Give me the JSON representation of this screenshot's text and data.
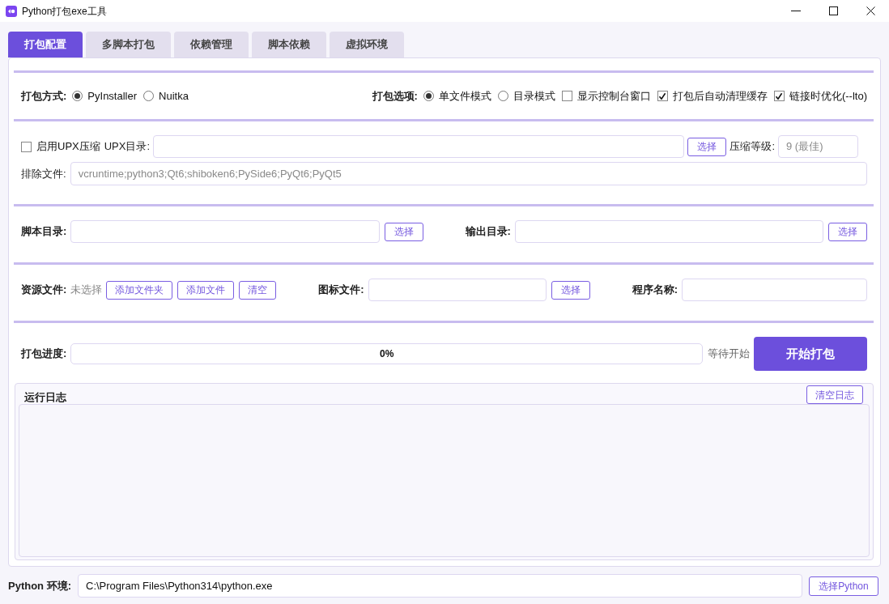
{
  "window": {
    "title": "Python打包exe工具"
  },
  "tabs": [
    {
      "label": "打包配置",
      "selected": true
    },
    {
      "label": "多脚本打包",
      "selected": false
    },
    {
      "label": "依赖管理",
      "selected": false
    },
    {
      "label": "脚本依赖",
      "selected": false
    },
    {
      "label": "虚拟环境",
      "selected": false
    }
  ],
  "packaging": {
    "method_label": "打包方式:",
    "methods": [
      {
        "label": "PyInstaller",
        "selected": true
      },
      {
        "label": "Nuitka",
        "selected": false
      }
    ],
    "options_label": "打包选项:",
    "options": [
      {
        "kind": "radio",
        "label": "单文件模式",
        "selected": true
      },
      {
        "kind": "radio",
        "label": "目录模式",
        "selected": false
      },
      {
        "kind": "checkbox",
        "label": "显示控制台窗口",
        "checked": false
      },
      {
        "kind": "checkbox",
        "label": "打包后自动清理缓存",
        "checked": true
      },
      {
        "kind": "checkbox",
        "label": "链接时优化(--lto)",
        "checked": true
      }
    ]
  },
  "upx": {
    "enable": {
      "label": "启用UPX压缩",
      "checked": false
    },
    "dir_label": "UPX目录:",
    "dir_button": "选择",
    "level_label": "压缩等级:",
    "level_field": {
      "value": "9 (最佳)",
      "disabled": true
    },
    "exclude_label": "排除文件:",
    "exclude_field": {
      "value": "vcruntime;python3;Qt6;shiboken6;PySide6;PyQt6;PyQt5",
      "disabled": true
    }
  },
  "directories": [
    {
      "label": "脚本目录:",
      "button": "选择"
    },
    {
      "label": "输出目录:",
      "button": "选择"
    }
  ],
  "resources": {
    "label": "资源文件:",
    "status": "未选择",
    "buttons": [
      "添加文件夹",
      "添加文件",
      "清空"
    ],
    "icon_label": "图标文件:",
    "icon_button": "选择",
    "name_label": "程序名称:"
  },
  "progress": {
    "label": "打包进度:",
    "level": 0,
    "reading": "0%",
    "status": "等待开始",
    "button": "开始打包"
  },
  "log": {
    "title": "运行日志",
    "button": "清空日志"
  },
  "python_env": {
    "label": "Python 环境:",
    "value": "C:\\Program Files\\Python314\\python.exe",
    "button": "选择Python"
  }
}
